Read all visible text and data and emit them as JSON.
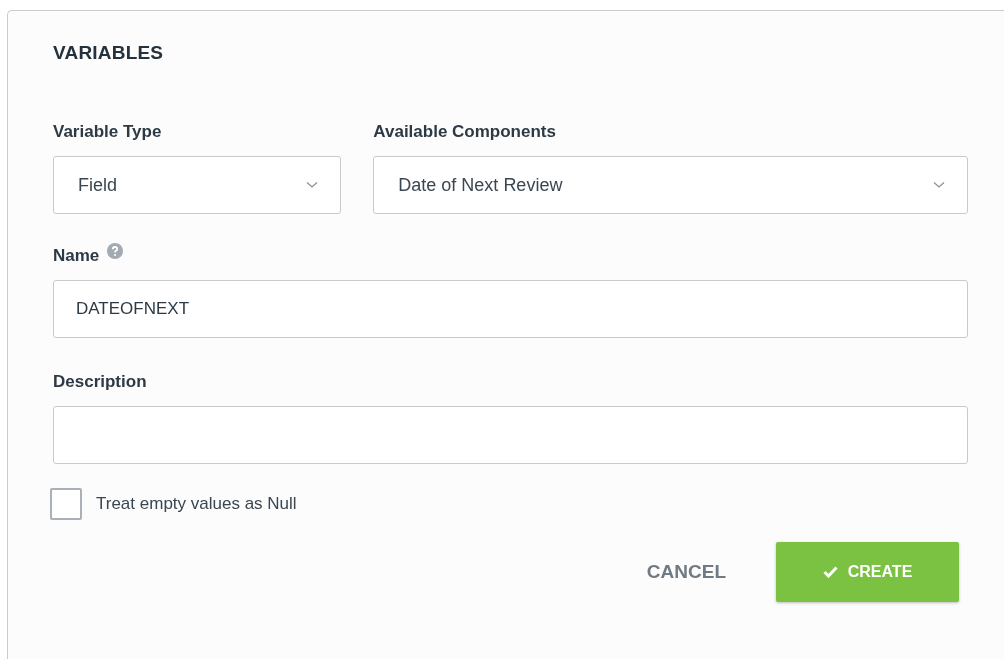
{
  "title": "VARIABLES",
  "variable_type": {
    "label": "Variable Type",
    "value": "Field"
  },
  "available_components": {
    "label": "Available Components",
    "value": "Date of Next Review"
  },
  "name": {
    "label": "Name",
    "value": "DATEOFNEXT"
  },
  "description": {
    "label": "Description"
  },
  "treat_empty_as_null": {
    "label": "Treat empty values as Null",
    "checked": false
  },
  "buttons": [
    {
      "kind": "text",
      "label": "CANCEL"
    },
    {
      "kind": "primary",
      "label": "CREATE"
    }
  ]
}
